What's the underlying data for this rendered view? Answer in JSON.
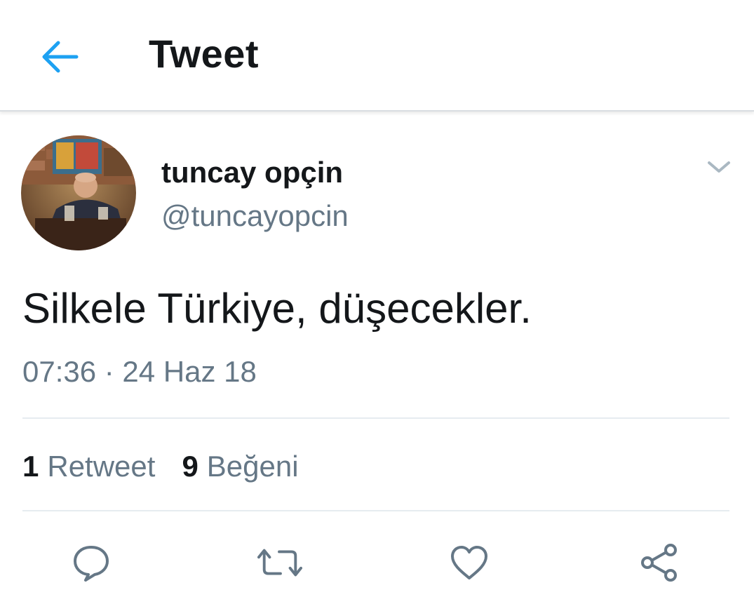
{
  "header": {
    "title": "Tweet",
    "back_icon": "back-arrow-icon"
  },
  "author": {
    "display_name": "tuncay opçin",
    "handle": "@tuncayopcin"
  },
  "tweet": {
    "text": "Silkele Türkiye, düşecekler.",
    "timestamp": "07:36 · 24 Haz 18"
  },
  "stats": {
    "retweet_count": "1",
    "retweet_label": "Retweet",
    "like_count": "9",
    "like_label": "Beğeni"
  },
  "actions": [
    {
      "icon": "reply-icon"
    },
    {
      "icon": "retweet-icon"
    },
    {
      "icon": "like-icon"
    },
    {
      "icon": "share-icon"
    }
  ],
  "colors": {
    "accent": "#1da1f2",
    "text": "#14171a",
    "secondary": "#657786",
    "divider": "#e6ecf0"
  }
}
